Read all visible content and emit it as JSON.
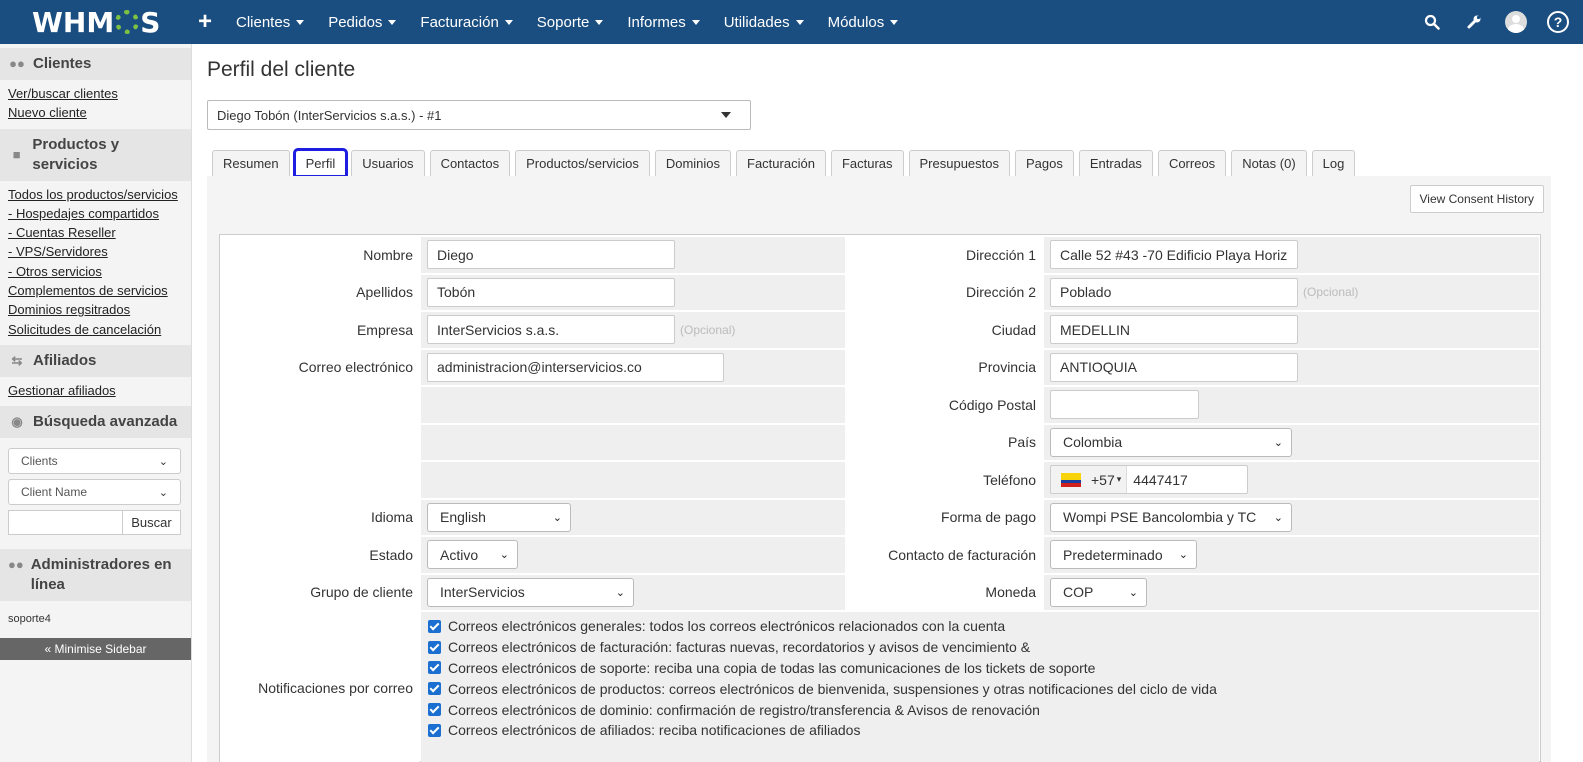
{
  "nav": {
    "logo": "WHMCS",
    "menu": [
      "Clientes",
      "Pedidos",
      "Facturación",
      "Soporte",
      "Informes",
      "Utilidades",
      "Módulos"
    ]
  },
  "sidebar": {
    "clients_title": "Clientes",
    "clients_links": [
      "Ver/buscar clientes",
      "Nuevo cliente"
    ],
    "products_title": "Productos y servicios",
    "products_links": [
      "Todos los productos/servicios",
      "- Hospedajes compartidos",
      "- Cuentas Reseller",
      "- VPS/Servidores",
      "- Otros servicios",
      "Complementos de servicios",
      "Dominios regsitrados",
      "Solicitudes de cancelación"
    ],
    "affiliates_title": "Afiliados",
    "affiliates_links": [
      "Gestionar afiliados"
    ],
    "search_title": "Búsqueda avanzada",
    "search_type": "Clients",
    "search_field": "Client Name",
    "search_button": "Buscar",
    "admins_title": "Administradores en línea",
    "admins": [
      "soporte4"
    ],
    "minimise": "« Minimise Sidebar"
  },
  "page": {
    "title": "Perfil del cliente",
    "client_selector": "Diego Tobón (InterServicios s.a.s.) - #1",
    "tabs": [
      "Resumen",
      "Perfil",
      "Usuarios",
      "Contactos",
      "Productos/servicios",
      "Dominios",
      "Facturación",
      "Facturas",
      "Presupuestos",
      "Pagos",
      "Entradas",
      "Correos",
      "Notas (0)",
      "Log"
    ],
    "active_tab": "Perfil",
    "consent_button": "View Consent History"
  },
  "form": {
    "optional": "(Opcional)",
    "left": {
      "nombre_label": "Nombre",
      "nombre": "Diego",
      "apellidos_label": "Apellidos",
      "apellidos": "Tobón",
      "empresa_label": "Empresa",
      "empresa": "InterServicios s.a.s.",
      "correo_label": "Correo electrónico",
      "correo": "administracion@interservicios.co",
      "idioma_label": "Idioma",
      "idioma": "English",
      "estado_label": "Estado",
      "estado": "Activo",
      "grupo_label": "Grupo de cliente",
      "grupo": "InterServicios"
    },
    "right": {
      "dir1_label": "Dirección 1",
      "dir1": "Calle 52 #43 -70 Edificio Playa Horiz",
      "dir2_label": "Dirección 2",
      "dir2": "Poblado",
      "ciudad_label": "Ciudad",
      "ciudad": "MEDELLIN",
      "provincia_label": "Provincia",
      "provincia": "ANTIOQUIA",
      "cp_label": "Código Postal",
      "cp": "",
      "pais_label": "País",
      "pais": "Colombia",
      "telefono_label": "Teléfono",
      "telefono_code": "+57",
      "telefono": "4447417",
      "pago_label": "Forma de pago",
      "pago": "Wompi PSE Bancolombia y TC",
      "contacto_label": "Contacto de facturación",
      "contacto": "Predeterminado",
      "moneda_label": "Moneda",
      "moneda": "COP"
    },
    "notif_label": "Notificaciones por correo",
    "notifications": [
      "Correos electrónicos generales: todos los correos electrónicos relacionados con la cuenta",
      "Correos electrónicos de facturación: facturas nuevas, recordatorios y avisos de vencimiento &",
      "Correos electrónicos de soporte: reciba una copia de todas las comunicaciones de los tickets de soporte",
      "Correos electrónicos de productos: correos electrónicos de bienvenida, suspensiones y otras notificaciones del ciclo de vida",
      "Correos electrónicos de dominio: confirmación de registro/transferencia & Avisos de renovación",
      "Correos electrónicos de afiliados: reciba notificaciones de afiliados"
    ]
  },
  "colors": {
    "nav_bg": "#1a4d80",
    "active_tab_outline": "#1e1ee0",
    "checkbox": "#1a6fd1"
  }
}
